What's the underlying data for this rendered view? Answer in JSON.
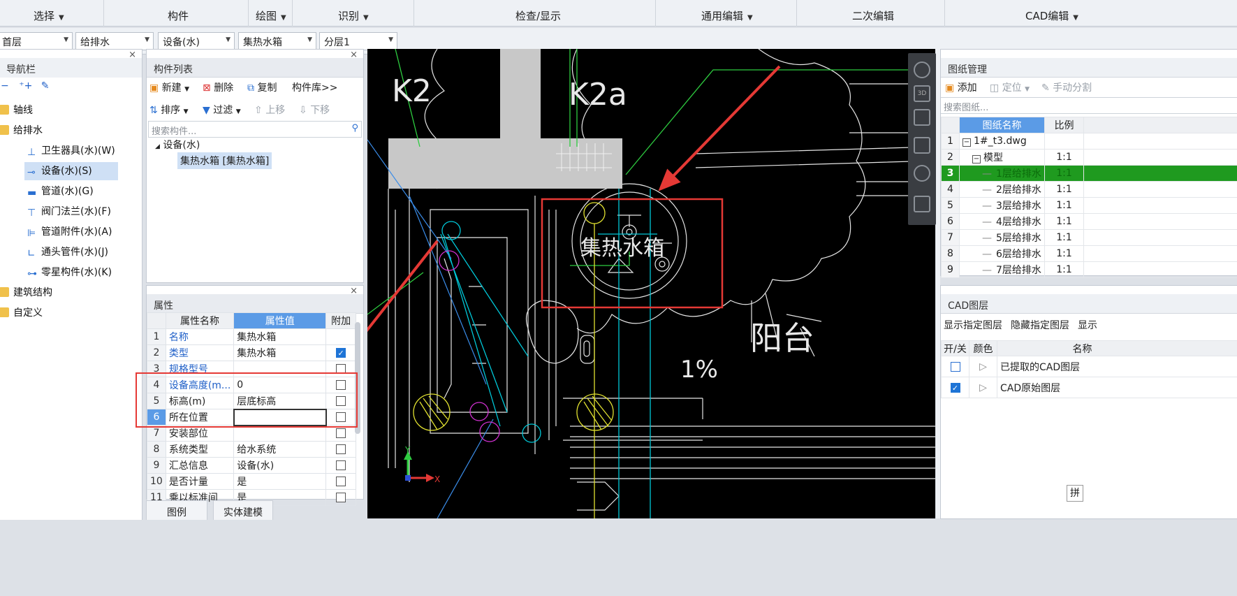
{
  "ribbon": {
    "groups": [
      {
        "label": "选择",
        "has_menu": true
      },
      {
        "label": "构件",
        "has_menu": false
      },
      {
        "label": "绘图",
        "has_menu": true
      },
      {
        "label": "识别",
        "has_menu": true
      },
      {
        "label": "检查/显示",
        "has_menu": false
      },
      {
        "label": "通用编辑",
        "has_menu": true
      },
      {
        "label": "二次编辑",
        "has_menu": false
      },
      {
        "label": "CAD编辑",
        "has_menu": true
      }
    ]
  },
  "selectors": {
    "floor": "首层",
    "discipline": "给排水",
    "type": "设备(水)",
    "component": "集热水箱",
    "layer": "分层1"
  },
  "nav": {
    "title": "导航栏",
    "items": [
      {
        "label": "轴线",
        "icon": "folder-icon"
      },
      {
        "label": "给排水",
        "icon": "folder-icon"
      },
      {
        "label": "卫生器具(水)(W)",
        "icon": "sink-icon"
      },
      {
        "label": "设备(水)(S)",
        "icon": "equipment-icon",
        "selected": true
      },
      {
        "label": "管道(水)(G)",
        "icon": "pipe-icon"
      },
      {
        "label": "阀门法兰(水)(F)",
        "icon": "valve-icon"
      },
      {
        "label": "管道附件(水)(A)",
        "icon": "pipe-accessory-icon"
      },
      {
        "label": "通头管件(水)(J)",
        "icon": "fitting-icon"
      },
      {
        "label": "零星构件(水)(K)",
        "icon": "misc-component-icon"
      },
      {
        "label": "建筑结构",
        "icon": "folder-icon"
      },
      {
        "label": "自定义",
        "icon": "folder-icon"
      }
    ]
  },
  "component_list": {
    "title": "构件列表",
    "toolbar1": {
      "new": "新建",
      "delete": "删除",
      "copy": "复制",
      "library": "构件库>>"
    },
    "toolbar2": {
      "sort": "排序",
      "filter": "过滤",
      "up": "上移",
      "down": "下移"
    },
    "search_placeholder": "搜索构件...",
    "tree_root": "设备(水)",
    "tree_item": "集热水箱 [集热水箱]"
  },
  "properties": {
    "title": "属性",
    "headers": {
      "name": "属性名称",
      "value": "属性值",
      "extra": "附加"
    },
    "rows": [
      {
        "no": "1",
        "name": "名称",
        "value": "集热水箱",
        "blue": true,
        "checked": null
      },
      {
        "no": "2",
        "name": "类型",
        "value": "集热水箱",
        "blue": true,
        "checked": true
      },
      {
        "no": "3",
        "name": "规格型号",
        "value": "",
        "blue": true,
        "checked": false
      },
      {
        "no": "4",
        "name": "设备高度(m...",
        "value": "0",
        "blue": true,
        "checked": false
      },
      {
        "no": "5",
        "name": "标高(m)",
        "value": "层底标高",
        "blue": false,
        "checked": false
      },
      {
        "no": "6",
        "name": "所在位置",
        "value": "",
        "blue": false,
        "checked": false,
        "active": true
      },
      {
        "no": "7",
        "name": "安装部位",
        "value": "",
        "blue": false,
        "checked": false
      },
      {
        "no": "8",
        "name": "系统类型",
        "value": "给水系统",
        "blue": false,
        "checked": false
      },
      {
        "no": "9",
        "name": "汇总信息",
        "value": "设备(水)",
        "blue": false,
        "checked": false
      },
      {
        "no": "10",
        "name": "是否计量",
        "value": "是",
        "blue": false,
        "checked": false
      },
      {
        "no": "11",
        "name": "乘以标准间",
        "value": "是",
        "blue": false,
        "checked": false
      }
    ],
    "tabs": {
      "legend": "图例",
      "solid": "实体建模"
    }
  },
  "cad": {
    "labels": {
      "k2": "K2",
      "k2a": "K2a",
      "tank": "集热水箱",
      "balcony": "阳台",
      "percent": "1%",
      "axis_x": "X",
      "axis_y": "Y"
    },
    "view_tools": [
      "orbit-icon",
      "3d-view-icon",
      "top-view-icon",
      "front-view-icon",
      "rotate-icon",
      "grid-icon"
    ]
  },
  "drawing_mgmt": {
    "title": "图纸管理",
    "toolbar": {
      "add": "添加",
      "locate": "定位",
      "split": "手动分割"
    },
    "search_placeholder": "搜索图纸...",
    "headers": {
      "name": "图纸名称",
      "scale": "比例"
    },
    "rows": [
      {
        "no": "1",
        "name": "1#_t3.dwg",
        "scale": "",
        "indent": 0,
        "toggle": "−"
      },
      {
        "no": "2",
        "name": "模型",
        "scale": "1:1",
        "indent": 1,
        "toggle": "−"
      },
      {
        "no": "3",
        "name": "1层给排水",
        "scale": "1:1",
        "indent": 2,
        "selected": true
      },
      {
        "no": "4",
        "name": "2层给排水",
        "scale": "1:1",
        "indent": 2
      },
      {
        "no": "5",
        "name": "3层给排水",
        "scale": "1:1",
        "indent": 2
      },
      {
        "no": "6",
        "name": "4层给排水",
        "scale": "1:1",
        "indent": 2
      },
      {
        "no": "7",
        "name": "5层给排水",
        "scale": "1:1",
        "indent": 2
      },
      {
        "no": "8",
        "name": "6层给排水",
        "scale": "1:1",
        "indent": 2
      },
      {
        "no": "9",
        "name": "7层给排水",
        "scale": "1:1",
        "indent": 2
      }
    ]
  },
  "cad_layers": {
    "title": "CAD图层",
    "toolbar": {
      "show": "显示指定图层",
      "hide": "隐藏指定图层",
      "more": "显示"
    },
    "headers": {
      "toggle": "开/关",
      "color": "颜色",
      "name": "名称"
    },
    "rows": [
      {
        "name": "已提取的CAD图层",
        "checked": false
      },
      {
        "name": "CAD原始图层",
        "checked": true
      }
    ],
    "corner_glyph": "拼"
  },
  "colors": {
    "accent": "#1e74d6",
    "highlight_red": "#e53935",
    "selected_row": "#1f9a1f"
  }
}
